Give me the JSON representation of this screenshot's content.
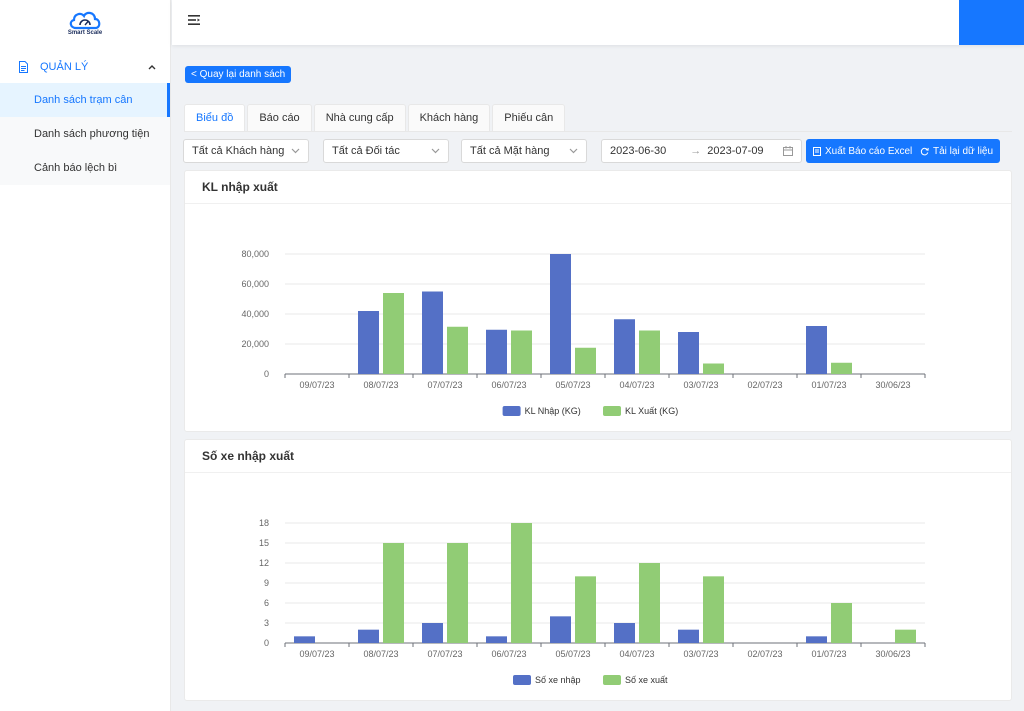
{
  "brand": {
    "name": "Smart Scale"
  },
  "sidebar": {
    "group_label": "QUẢN LÝ",
    "items": [
      {
        "label": "Danh sách trạm cân",
        "active": true
      },
      {
        "label": "Danh sách phương tiện",
        "active": false
      },
      {
        "label": "Cảnh báo lệch bì",
        "active": false
      }
    ]
  },
  "main": {
    "back_label": "< Quay lại danh sách",
    "tabs": [
      {
        "label": "Biểu đồ",
        "active": true
      },
      {
        "label": "Báo cáo",
        "active": false
      },
      {
        "label": "Nhà cung cấp",
        "active": false
      },
      {
        "label": "Khách hàng",
        "active": false
      },
      {
        "label": "Phiếu cân",
        "active": false
      }
    ],
    "filters": {
      "customer": "Tất cả Khách hàng",
      "partner": "Tất cả Đối tác",
      "product": "Tất cả Mặt hàng",
      "date_from": "2023-06-30",
      "date_sep": "→",
      "date_to": "2023-07-09"
    },
    "actions": {
      "export_label": "Xuất Báo cáo Excel",
      "reload_label": "Tải lại dữ liệu"
    }
  },
  "colors": {
    "accent": "#1677ff",
    "series_in": "#5470c6",
    "series_out": "#91cc75"
  },
  "chart_data": [
    {
      "type": "bar",
      "title": "KL nhập xuất",
      "categories": [
        "09/07/23",
        "08/07/23",
        "07/07/23",
        "06/07/23",
        "05/07/23",
        "04/07/23",
        "03/07/23",
        "02/07/23",
        "01/07/23",
        "30/06/23"
      ],
      "series": [
        {
          "name": "KL Nhập (KG)",
          "values": [
            0,
            42000,
            55000,
            29500,
            80000,
            36500,
            28000,
            0,
            32000,
            0
          ]
        },
        {
          "name": "KL Xuất (KG)",
          "values": [
            0,
            54000,
            31500,
            29000,
            17500,
            29000,
            7000,
            0,
            7500,
            0
          ]
        }
      ],
      "yticks": [
        "0",
        "20,000",
        "40,000",
        "60,000",
        "80,000"
      ],
      "ylim": [
        0,
        80000
      ],
      "legend": "bottom",
      "grid": true
    },
    {
      "type": "bar",
      "title": "Số xe nhập xuất",
      "categories": [
        "09/07/23",
        "08/07/23",
        "07/07/23",
        "06/07/23",
        "05/07/23",
        "04/07/23",
        "03/07/23",
        "02/07/23",
        "01/07/23",
        "30/06/23"
      ],
      "series": [
        {
          "name": "Số xe nhập",
          "values": [
            1,
            2,
            3,
            1,
            4,
            3,
            2,
            0,
            1,
            0
          ]
        },
        {
          "name": "Số xe xuất",
          "values": [
            0,
            15,
            15,
            18,
            10,
            12,
            10,
            0,
            6,
            2
          ]
        }
      ],
      "yticks": [
        "0",
        "3",
        "6",
        "9",
        "12",
        "15",
        "18"
      ],
      "ylim": [
        0,
        18
      ],
      "legend": "bottom",
      "grid": true
    }
  ]
}
